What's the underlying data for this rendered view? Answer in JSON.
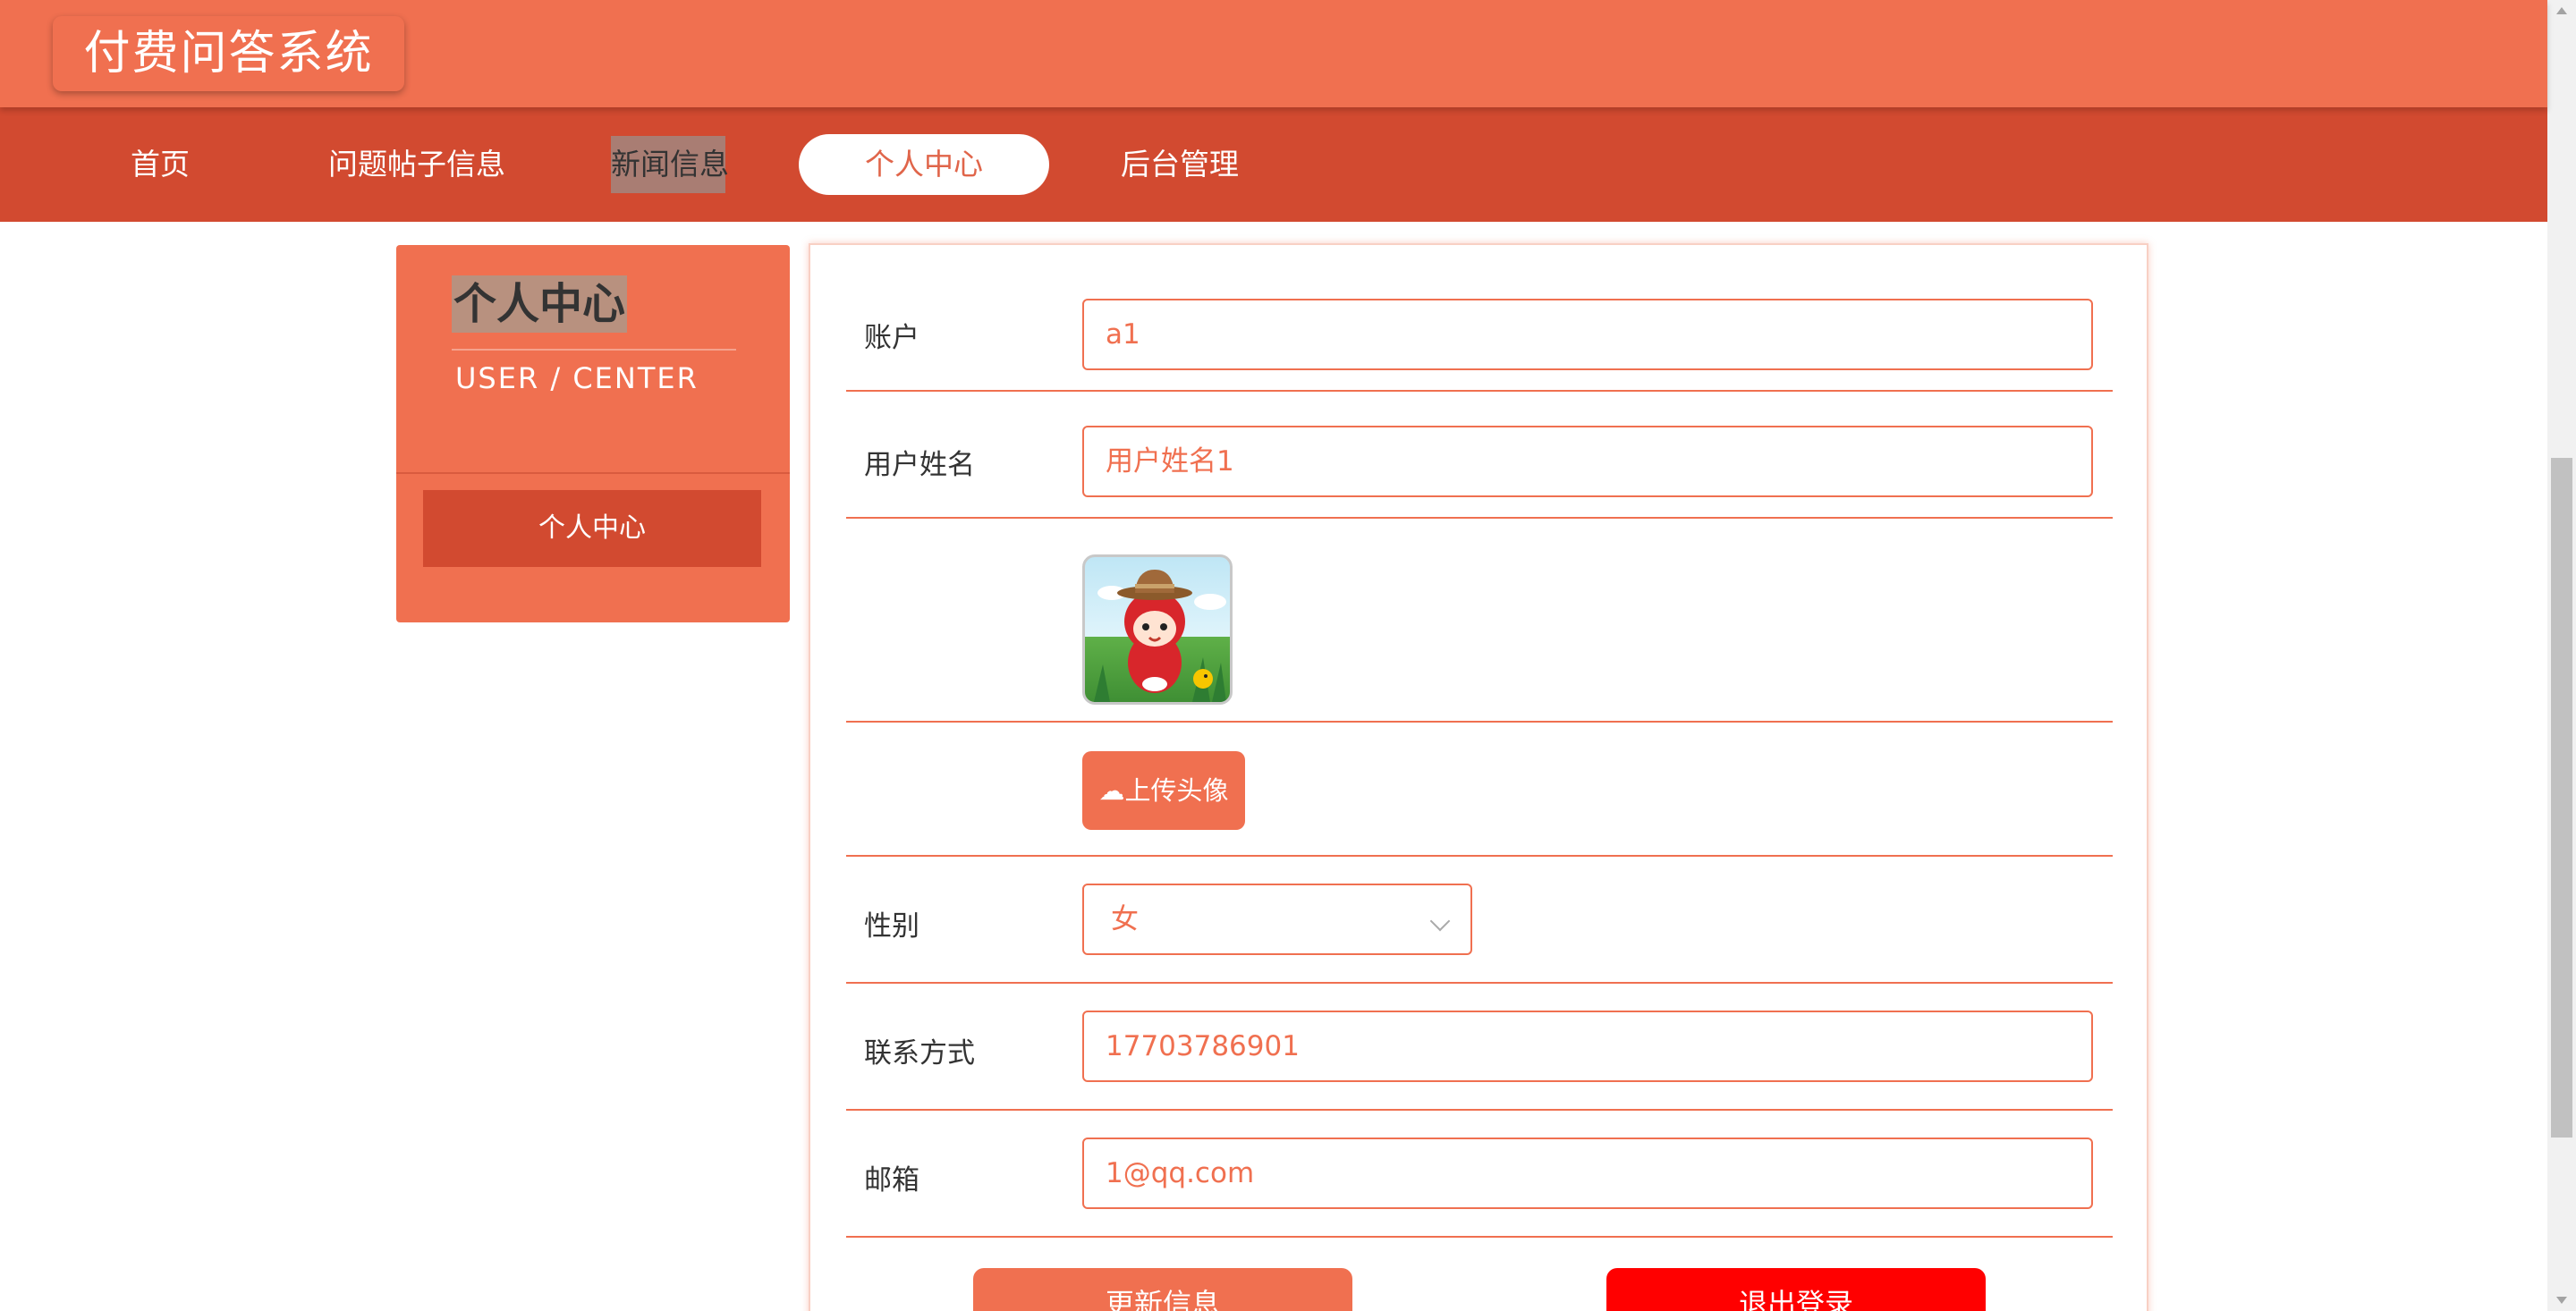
{
  "header": {
    "site_title": "付费问答系统"
  },
  "nav": {
    "items": [
      {
        "label": "首页"
      },
      {
        "label": "问题帖子信息"
      },
      {
        "label": "新闻信息"
      },
      {
        "label": "个人中心",
        "active": true
      },
      {
        "label": "后台管理"
      }
    ]
  },
  "sidebar": {
    "title": "个人中心",
    "subtitle": "USER / CENTER",
    "menu_item": "个人中心"
  },
  "form": {
    "account_label": "账户",
    "account_value": "a1",
    "name_label": "用户姓名",
    "name_value": "用户姓名1",
    "avatar_icon": "cartoon-avatar",
    "upload_label": "上传头像",
    "gender_label": "性别",
    "gender_value": "女",
    "phone_label": "联系方式",
    "phone_value": "17703786901",
    "email_label": "邮箱",
    "email_value": "1@qq.com",
    "update_button": "更新信息",
    "logout_button": "退出登录"
  },
  "colors": {
    "primary": "#f07050",
    "nav_bg": "#d24a30",
    "logout": "#ff0000"
  }
}
